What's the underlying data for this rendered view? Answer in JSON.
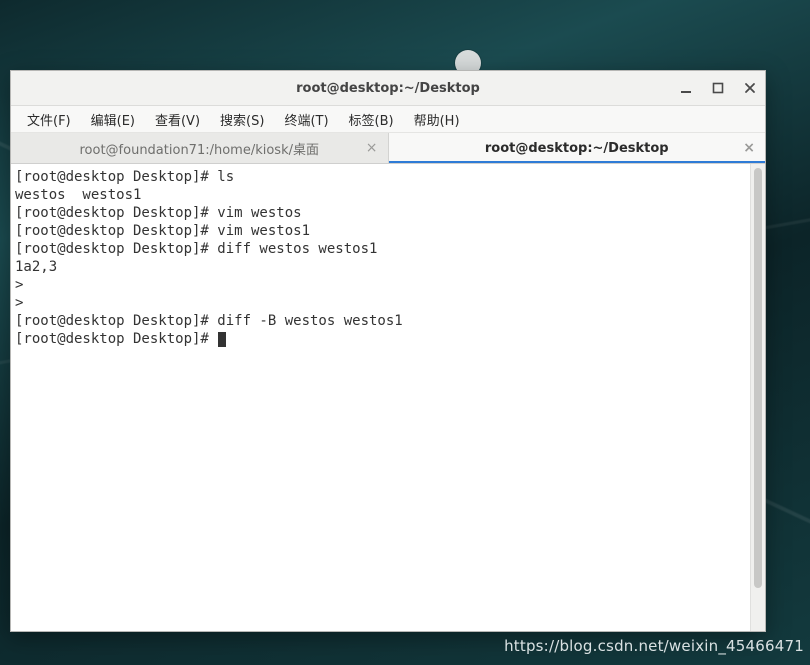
{
  "attribution": "https://blog.csdn.net/weixin_45466471",
  "window": {
    "title": "root@desktop:~/Desktop",
    "controls": {
      "minimize": "minimize",
      "maximize": "maximize",
      "close": "close"
    }
  },
  "menu": {
    "items": [
      "文件(F)",
      "编辑(E)",
      "查看(V)",
      "搜索(S)",
      "终端(T)",
      "标签(B)",
      "帮助(H)"
    ]
  },
  "tabs": [
    {
      "label": "root@foundation71:/home/kiosk/桌面",
      "active": false
    },
    {
      "label": "root@desktop:~/Desktop",
      "active": true
    }
  ],
  "terminal": {
    "lines": [
      "[root@desktop Desktop]# ls",
      "westos  westos1",
      "[root@desktop Desktop]# vim westos",
      "[root@desktop Desktop]# vim westos1",
      "[root@desktop Desktop]# diff westos westos1",
      "1a2,3",
      ">",
      ">",
      "[root@desktop Desktop]# diff -B westos westos1",
      "[root@desktop Desktop]# "
    ],
    "cursor_on_last_line": true
  }
}
